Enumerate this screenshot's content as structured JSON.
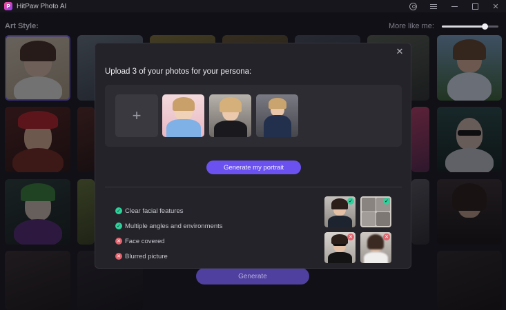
{
  "window": {
    "title": "HitPaw Photo AI"
  },
  "header": {
    "art_style_label": "Art Style:",
    "more_like_label": "More like me:",
    "slider_value": 0.75
  },
  "background": {
    "generate_label": "Generate"
  },
  "modal": {
    "title": "Upload 3 of your photos for your persona:",
    "add_symbol": "+",
    "generate_label": "Generate my portrait",
    "rules": [
      {
        "text": "Clear facial features",
        "status": "ok"
      },
      {
        "text": "Multiple angles and environments",
        "status": "ok"
      },
      {
        "text": "Face covered",
        "status": "bad"
      },
      {
        "text": "Blurred picture",
        "status": "bad"
      }
    ]
  },
  "icons": {
    "ok": "✓",
    "bad": "✕",
    "close": "✕"
  },
  "colors": {
    "accent": "#6b52f0",
    "ok": "#2fd09a",
    "bad": "#e0656f"
  }
}
